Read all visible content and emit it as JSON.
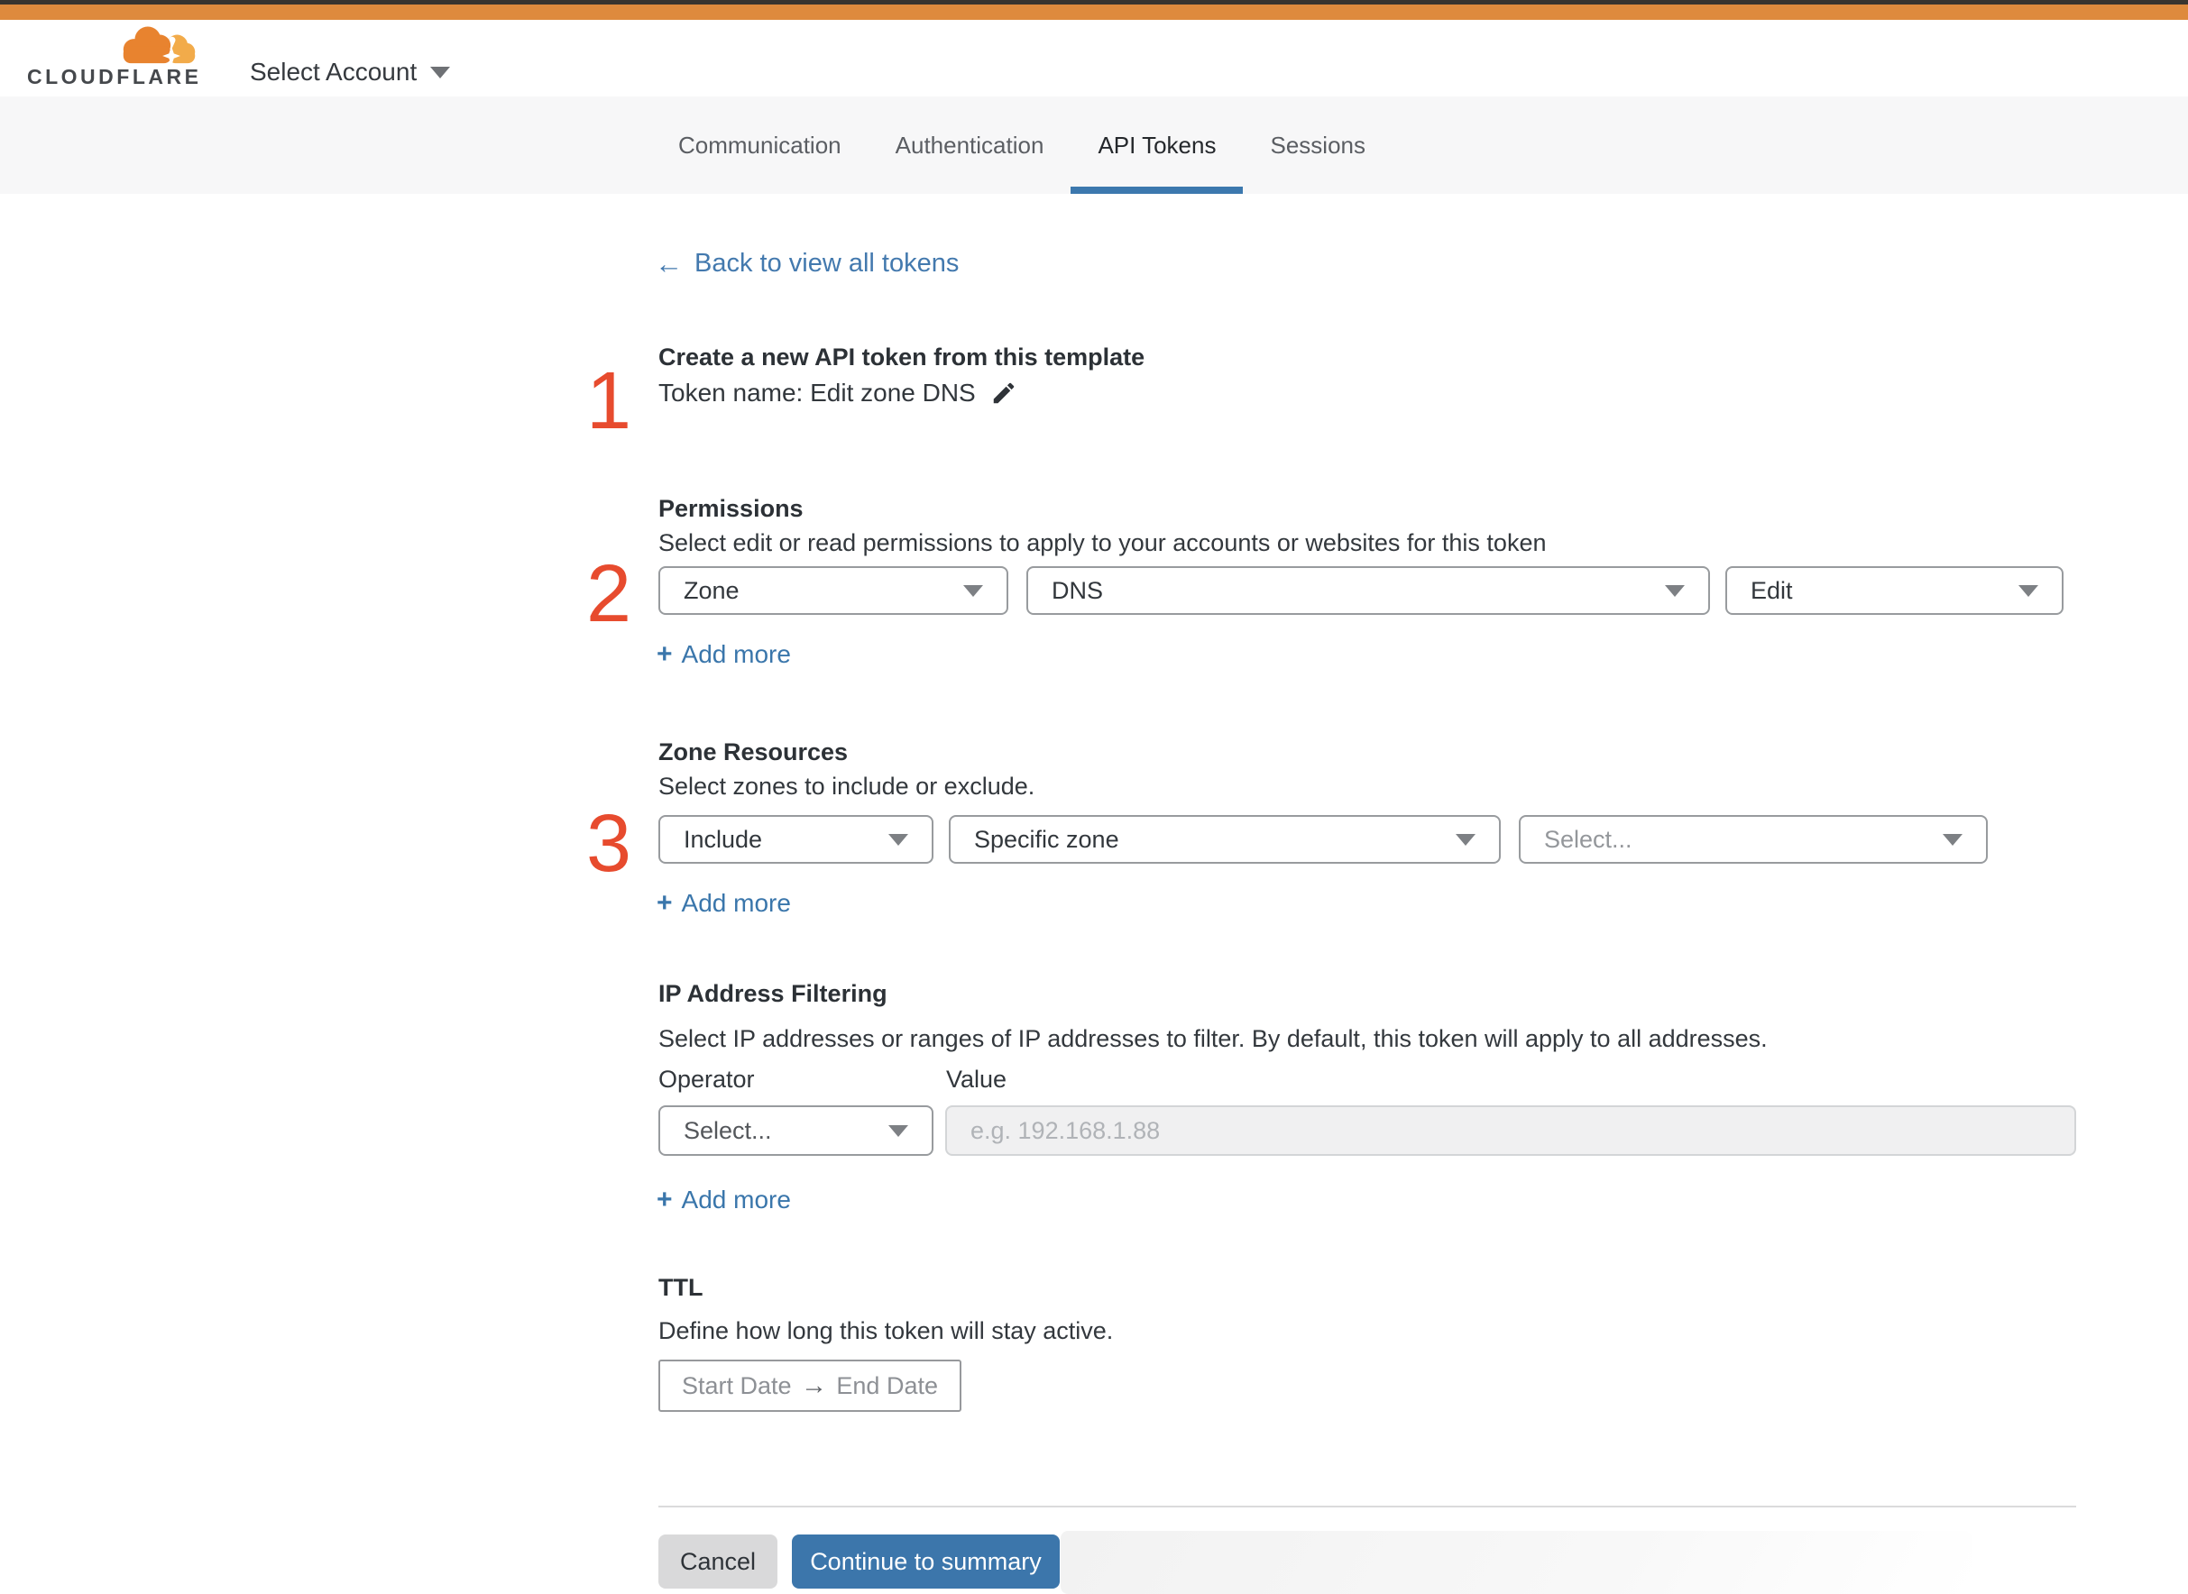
{
  "header": {
    "logo_text": "CLOUDFLARE",
    "account_selector": "Select Account"
  },
  "tabs": [
    {
      "label": "Communication",
      "active": false
    },
    {
      "label": "Authentication",
      "active": false
    },
    {
      "label": "API Tokens",
      "active": true
    },
    {
      "label": "Sessions",
      "active": false
    }
  ],
  "back": {
    "arrow_icon": "←",
    "label": "Back to view all tokens"
  },
  "add_more": {
    "plus_icon": "+",
    "label": "Add more"
  },
  "sections": {
    "template": {
      "step": "1",
      "title": "Create a new API token from this template",
      "token_name": "Token name: Edit zone DNS",
      "edit_icon": "pencil"
    },
    "permissions": {
      "step": "2",
      "title": "Permissions",
      "description": "Select edit or read permissions to apply to your accounts or websites for this token",
      "dropdowns": [
        {
          "value": "Zone"
        },
        {
          "value": "DNS"
        },
        {
          "value": "Edit"
        }
      ]
    },
    "zone_resources": {
      "step": "3",
      "title": "Zone Resources",
      "description": "Select zones to include or exclude.",
      "dropdowns": [
        {
          "value": "Include"
        },
        {
          "value": "Specific zone"
        },
        {
          "value": "Select..."
        }
      ]
    },
    "ip_filtering": {
      "title": "IP Address Filtering",
      "description": "Select IP addresses or ranges of IP addresses to filter. By default, this token will apply to all addresses.",
      "operator_label": "Operator",
      "value_label": "Value",
      "operator_value": "Select...",
      "value_placeholder": "e.g. 192.168.1.88"
    },
    "ttl": {
      "title": "TTL",
      "description": "Define how long this token will stay active.",
      "start_date": "Start Date",
      "arrow_icon": "→",
      "end_date": "End Date"
    }
  },
  "footer": {
    "cancel_label": "Cancel",
    "continue_label": "Continue to summary"
  },
  "colors": {
    "brand_orange": "#de8a3d",
    "accent_blue": "#3c76ab",
    "step_red": "#e74b2e",
    "active_tab_underline": "#3c78ae"
  }
}
